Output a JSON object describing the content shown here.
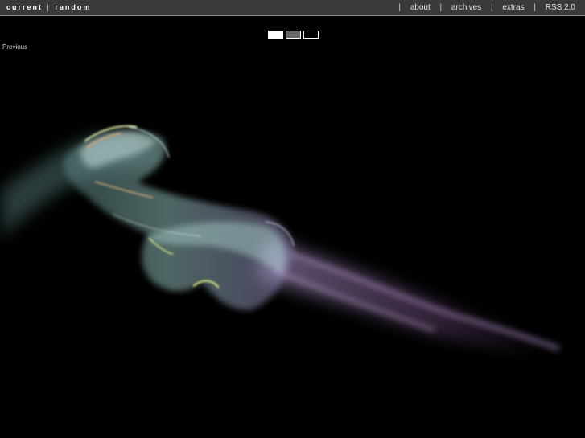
{
  "header": {
    "brand_current": "current",
    "brand_separator": "|",
    "brand_random": "random",
    "nav": [
      {
        "label": "about"
      },
      {
        "label": "archives"
      },
      {
        "label": "extras"
      },
      {
        "label": "RSS 2.0"
      }
    ],
    "nav_separator": "|"
  },
  "swatches": [
    {
      "name": "white",
      "color": "#ffffff"
    },
    {
      "name": "gray",
      "color": "#666666"
    },
    {
      "name": "black",
      "color": "#000000"
    }
  ],
  "navigation": {
    "previous_label": "Previous"
  },
  "photo": {
    "subject": "smoke-wisp",
    "background": "#000000"
  }
}
